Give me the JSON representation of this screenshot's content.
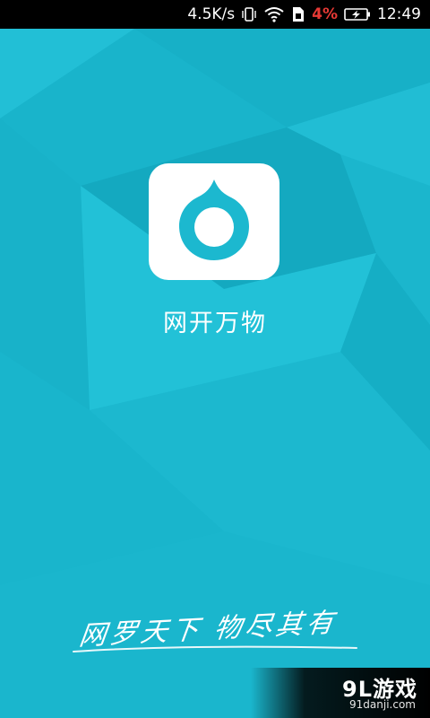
{
  "status_bar": {
    "network_speed": "4.5K/s",
    "battery_percent": "4%",
    "time": "12:49",
    "icons": [
      "vibrate-icon",
      "wifi-icon",
      "sim-icon",
      "battery-charging-icon"
    ]
  },
  "app": {
    "name": "网开万物",
    "slogan": "网罗天下 物尽其有",
    "logo_icon": "water-drop-ring-icon"
  },
  "watermark": {
    "brand": "9L游戏",
    "url": "91danji.com"
  },
  "colors": {
    "background": "#1cb8cf",
    "logo_ring": "#1cb8cf",
    "status_bar": "#000000",
    "battery_low": "#e53935"
  }
}
